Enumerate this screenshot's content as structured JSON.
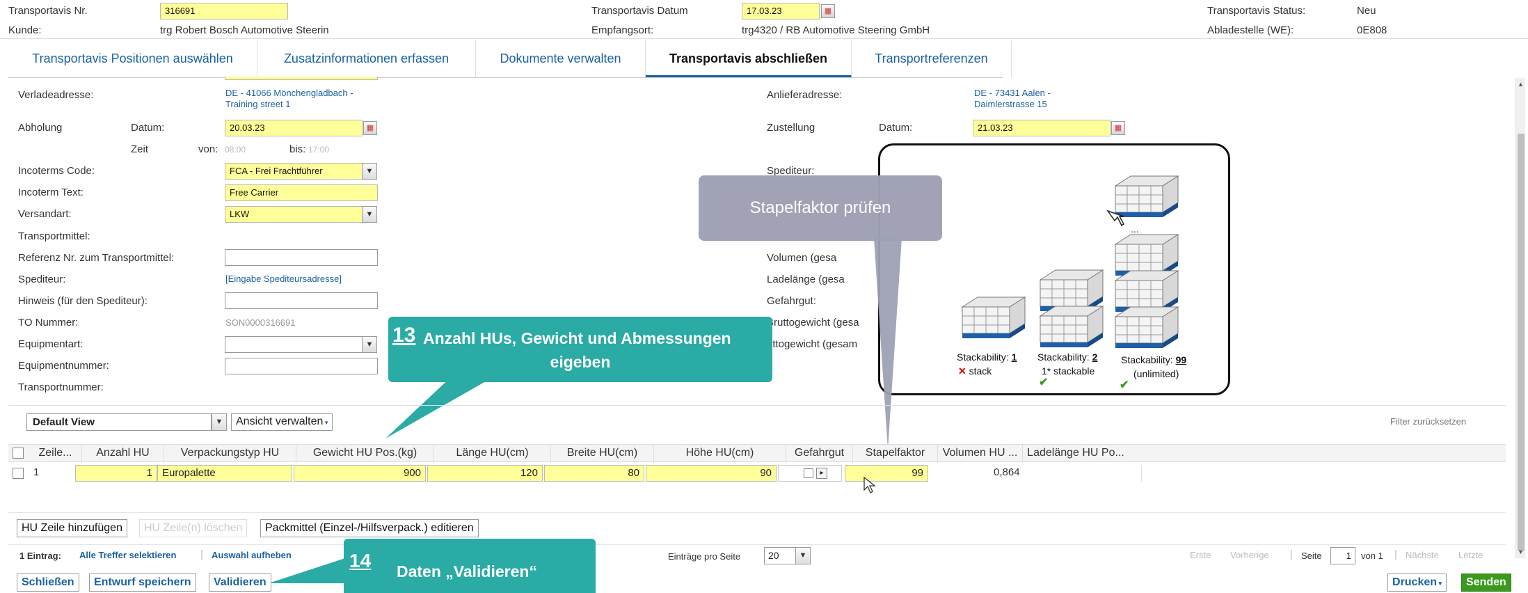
{
  "header": {
    "row1": {
      "nr_label": "Transportavis Nr.",
      "nr_value": "316691",
      "datum_label": "Transportavis Datum",
      "datum_value": "17.03.23",
      "status_label": "Transportavis Status:",
      "status_value": "Neu"
    },
    "row2": {
      "kunde_label": "Kunde:",
      "kunde_value": "trg Robert Bosch Automotive Steerin",
      "empfang_label": "Empfangsort:",
      "empfang_value": "trg4320 / RB Automotive Steering GmbH",
      "ablade_label": "Abladestelle (WE):",
      "ablade_value": "0E808"
    }
  },
  "tabs": [
    {
      "label": "Transportavis Positionen auswählen"
    },
    {
      "label": "Zusatzinformationen erfassen"
    },
    {
      "label": "Dokumente verwalten"
    },
    {
      "label": "Transportavis abschließen"
    },
    {
      "label": "Transportreferenzen"
    }
  ],
  "form_left": {
    "verlade_label": "Verladeadresse:",
    "verlade_line1": "DE - 41066 Mönchengladbach -",
    "verlade_line2": "Training street 1",
    "abholung_label": "Abholung",
    "datum_label": "Datum:",
    "abholung_datum": "20.03.23",
    "zeit_label": "Zeit",
    "von_label": "von:",
    "von_value": "08:00",
    "bis_label": "bis:",
    "bis_value": "17:00",
    "incoterms_code_label": "Incoterms Code:",
    "incoterms_code_value": "FCA - Frei Frachtführer",
    "incoterm_text_label": "Incoterm Text:",
    "incoterm_text_value": "Free Carrier",
    "versandart_label": "Versandart:",
    "versandart_value": "LKW",
    "transportmittel_label": "Transportmittel:",
    "referenz_label": "Referenz Nr. zum Transportmittel:",
    "spediteur_label": "Spediteur:",
    "spediteur_link": "[Eingabe Spediteursadresse]",
    "hinweis_label": "Hinweis (für den Spediteur):",
    "to_label": "TO Nummer:",
    "to_value": "SON0000316691",
    "equipmentart_label": "Equipmentart:",
    "equipmentnummer_label": "Equipmentnummer:",
    "transportnummer_label": "Transportnummer:"
  },
  "form_right": {
    "anliefer_label": "Anlieferadresse:",
    "anliefer_line1": "DE - 73431 Aalen -",
    "anliefer_line2": "Daimlerstrasse 15",
    "zustellung_label": "Zustellung",
    "datum_label": "Datum:",
    "zustellung_datum": "21.03.23",
    "spediteur_label": "Spediteur:",
    "volumen_label": "Volumen (gesa",
    "ladelaenge_label": "Ladelänge (gesa",
    "gefahrgut_label": "Gefahrgut:",
    "brutto_label": "Bruttogewicht (gesa",
    "netto_label": "ettogewicht (gesam"
  },
  "stack_image": {
    "items": [
      {
        "prefix": "Stackability: ",
        "num": "1",
        "sub": "stack"
      },
      {
        "prefix": "Stackability: ",
        "num": "2",
        "sub": "1* stackable"
      },
      {
        "prefix": "Stackability: ",
        "num": "99",
        "sub": "(unlimited)"
      }
    ],
    "dots": "..."
  },
  "callouts": {
    "stapel": "Stapelfaktor prüfen",
    "c13_num": "13",
    "c13_line1": "Anzahl HUs, Gewicht und Abmessungen",
    "c13_line2": "eigeben",
    "c14_num": "14",
    "c14_text": "Daten „Validieren“"
  },
  "view_bar": {
    "view_value": "Default View",
    "ansicht_label": "Ansicht verwalten",
    "filter_reset": "Filter zurücksetzen"
  },
  "grid": {
    "columns": [
      "Zeile...",
      "Anzahl HU",
      "Verpackungstyp HU",
      "Gewicht HU Pos.(kg)",
      "Länge HU(cm)",
      "Breite HU(cm)",
      "Höhe HU(cm)",
      "Gefahrgut",
      "Stapelfaktor",
      "Volumen HU ...",
      "Ladelänge HU Po..."
    ],
    "row": {
      "zeile": "1",
      "anzahl": "1",
      "verpackung": "Europalette",
      "gewicht": "900",
      "laenge": "120",
      "breite": "80",
      "hoehe": "90",
      "stapel": "99",
      "volumen": "0,864"
    }
  },
  "actions": {
    "add_row": "HU Zeile hinzufügen",
    "delete_row": "HU Zeile(n) löschen",
    "packmittel": "Packmittel (Einzel-/Hilfsverpack.) editieren"
  },
  "pager": {
    "eintrag": "1 Eintrag:",
    "alle": "Alle Treffer selektieren",
    "aufheben": "Auswahl aufheben",
    "eintraege_label": "Einträge pro Seite",
    "eintraege_value": "20",
    "erste": "Erste",
    "vorherige": "Vorherige",
    "seite_label": "Seite",
    "seite_value": "1",
    "von": "von 1",
    "naechste": "Nächste",
    "letzte": "Letzte"
  },
  "footer": {
    "schliessen": "Schließen",
    "entwurf": "Entwurf speichern",
    "validieren": "Validieren",
    "drucken": "Drucken",
    "senden": "Senden"
  },
  "colors": {
    "accent": "#1a62a3",
    "input_yellow": "#ffff99",
    "callout_teal": "#2aaba5",
    "tooltip_gray": "#9ea0b4",
    "send_green": "#3a9a1e"
  }
}
